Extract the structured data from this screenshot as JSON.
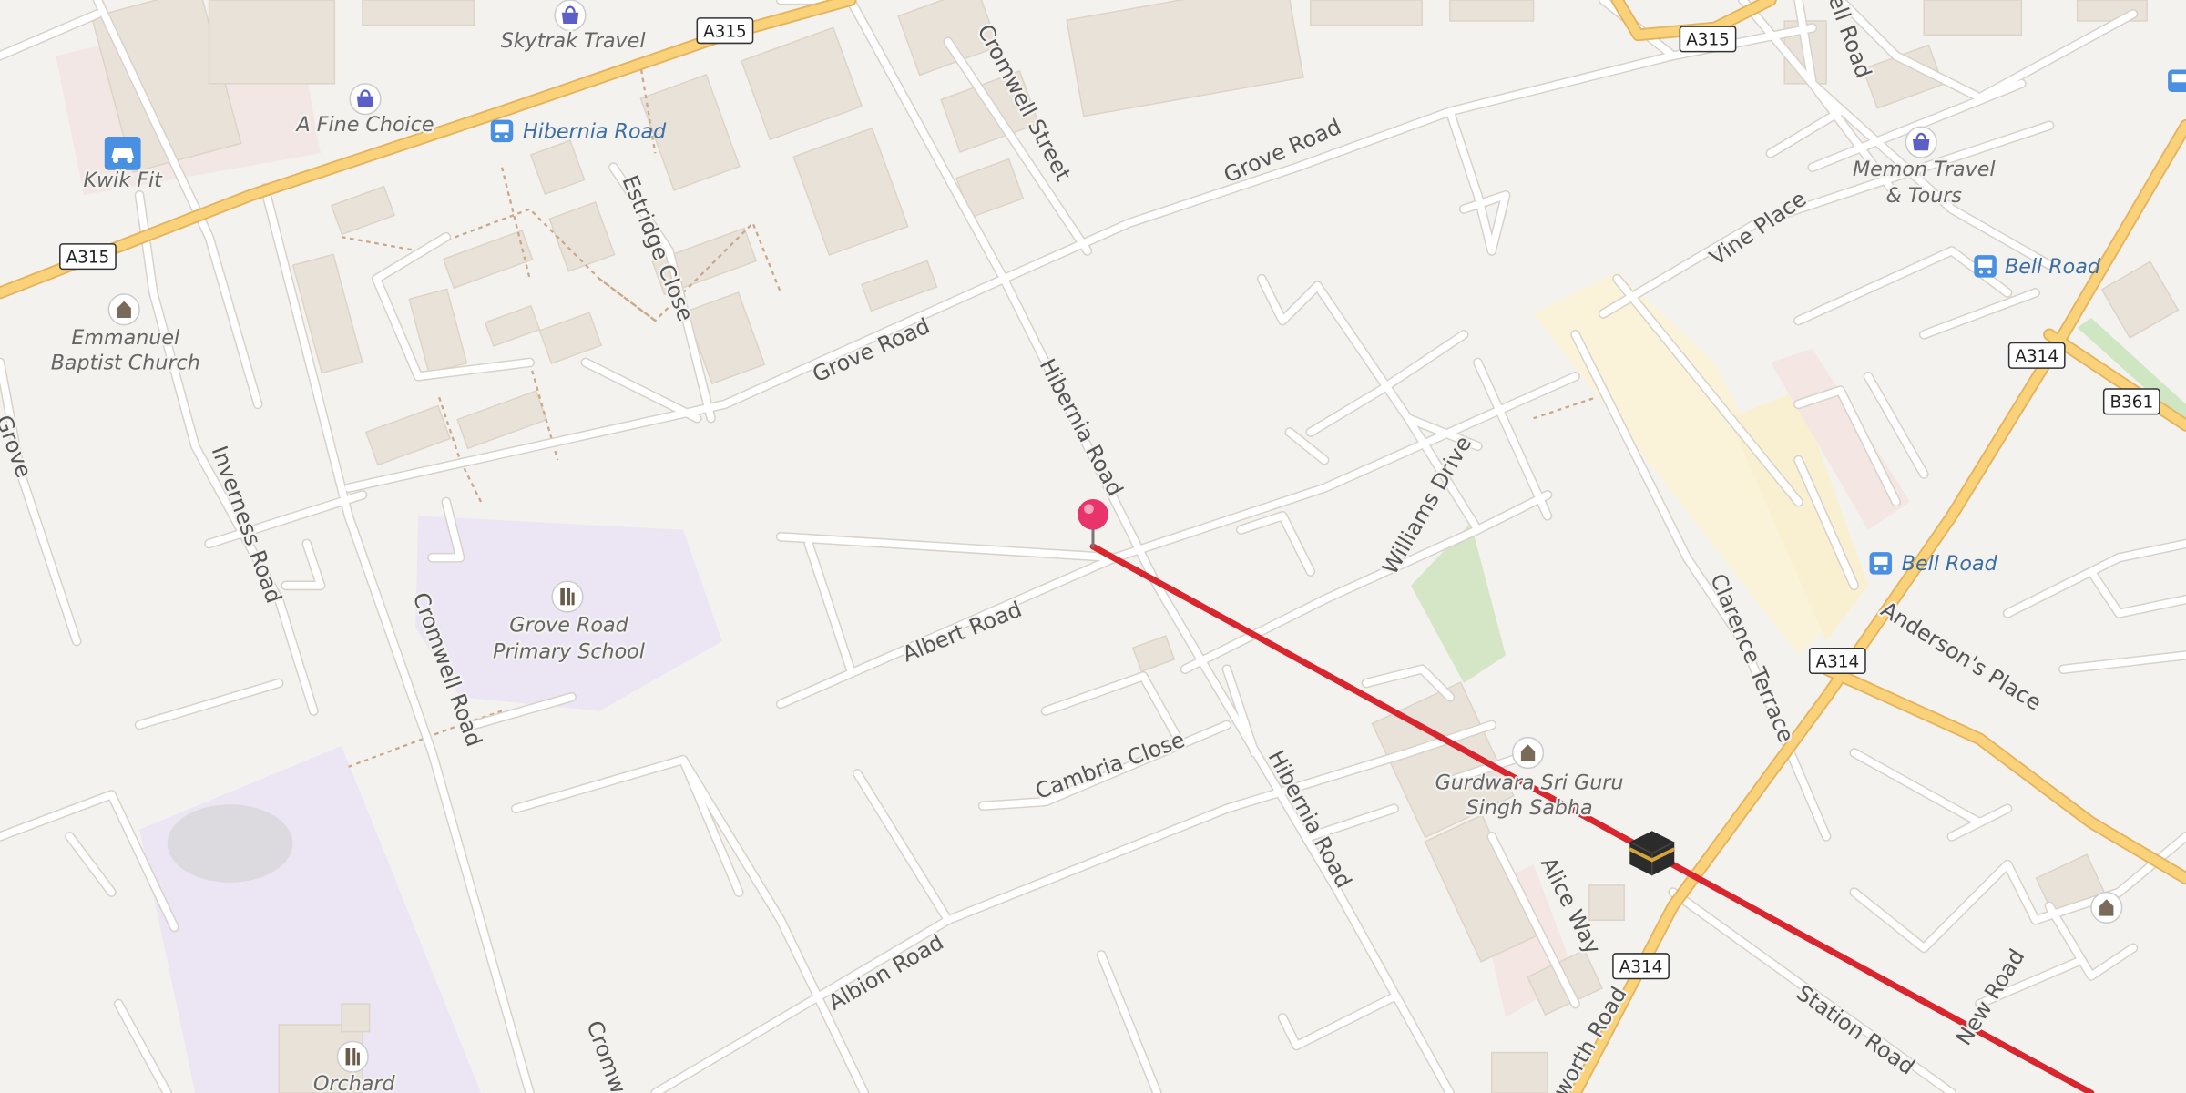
{
  "map": {
    "road_shields": [
      "A315",
      "A315",
      "A315",
      "A314",
      "B361",
      "A314",
      "A314"
    ],
    "streets": {
      "grove_road_1": "Grove Road",
      "grove_road_2": "Grove Road",
      "cromwell_street": "Cromwell Street",
      "estridge_close": "Estridge Close",
      "hibernia_road_1": "Hibernia Road",
      "hibernia_road_2": "Hibernia Road",
      "albert_road": "Albert Road",
      "cambria_close": "Cambria Close",
      "albion_road": "Albion Road",
      "williams_drive": "Williams Drive",
      "inverness_road": "Inverness Road",
      "cromwell_road": "Cromwell Road",
      "cromwell_bottom": "Cromw",
      "vine_place": "Vine Place",
      "clarence_terrace": "Clarence Terrace",
      "andersons_place": "Anderson's Place",
      "alice_way": "Alice Way",
      "station_road": "Station Road",
      "new_road": "New Road",
      "worth_road": "worth Road",
      "bell_road_top": "ell Road",
      "grove_left": "Grove"
    },
    "pois": {
      "skytrak": "Skytrak Travel",
      "fine_choice": "A Fine Choice",
      "kwik_fit": "Kwik Fit",
      "emmanuel_1": "Emmanuel",
      "emmanuel_2": "Baptist Church",
      "school_1": "Grove Road",
      "school_2": "Primary School",
      "orchard": "Orchard",
      "memon_1": "Memon Travel",
      "memon_2": "& Tours",
      "gurdwara_1": "Gurdwara Sri Guru",
      "gurdwara_2": "Singh Sabha"
    },
    "bus_stops": {
      "hibernia": "Hibernia Road",
      "bell_1": "Bell Road",
      "bell_2": "Bell Road"
    },
    "colors": {
      "background": "#f4f2ef",
      "road": "#ffffff",
      "road_casing": "#dcd7d0",
      "major_road": "#fad27a",
      "major_casing": "#e4b460",
      "building": "#e9e2d9",
      "school_area": "#ece6f4",
      "park": "#cfe3bf",
      "route_line": "#d9262e",
      "pin": "#e8336b",
      "bus_icon": "#4a90e2",
      "poi_icon": "#5b5fc7"
    },
    "icons": [
      "bag-icon",
      "bus-icon",
      "car-icon",
      "church-icon",
      "school-icon",
      "kaaba-icon",
      "pin-icon"
    ]
  }
}
